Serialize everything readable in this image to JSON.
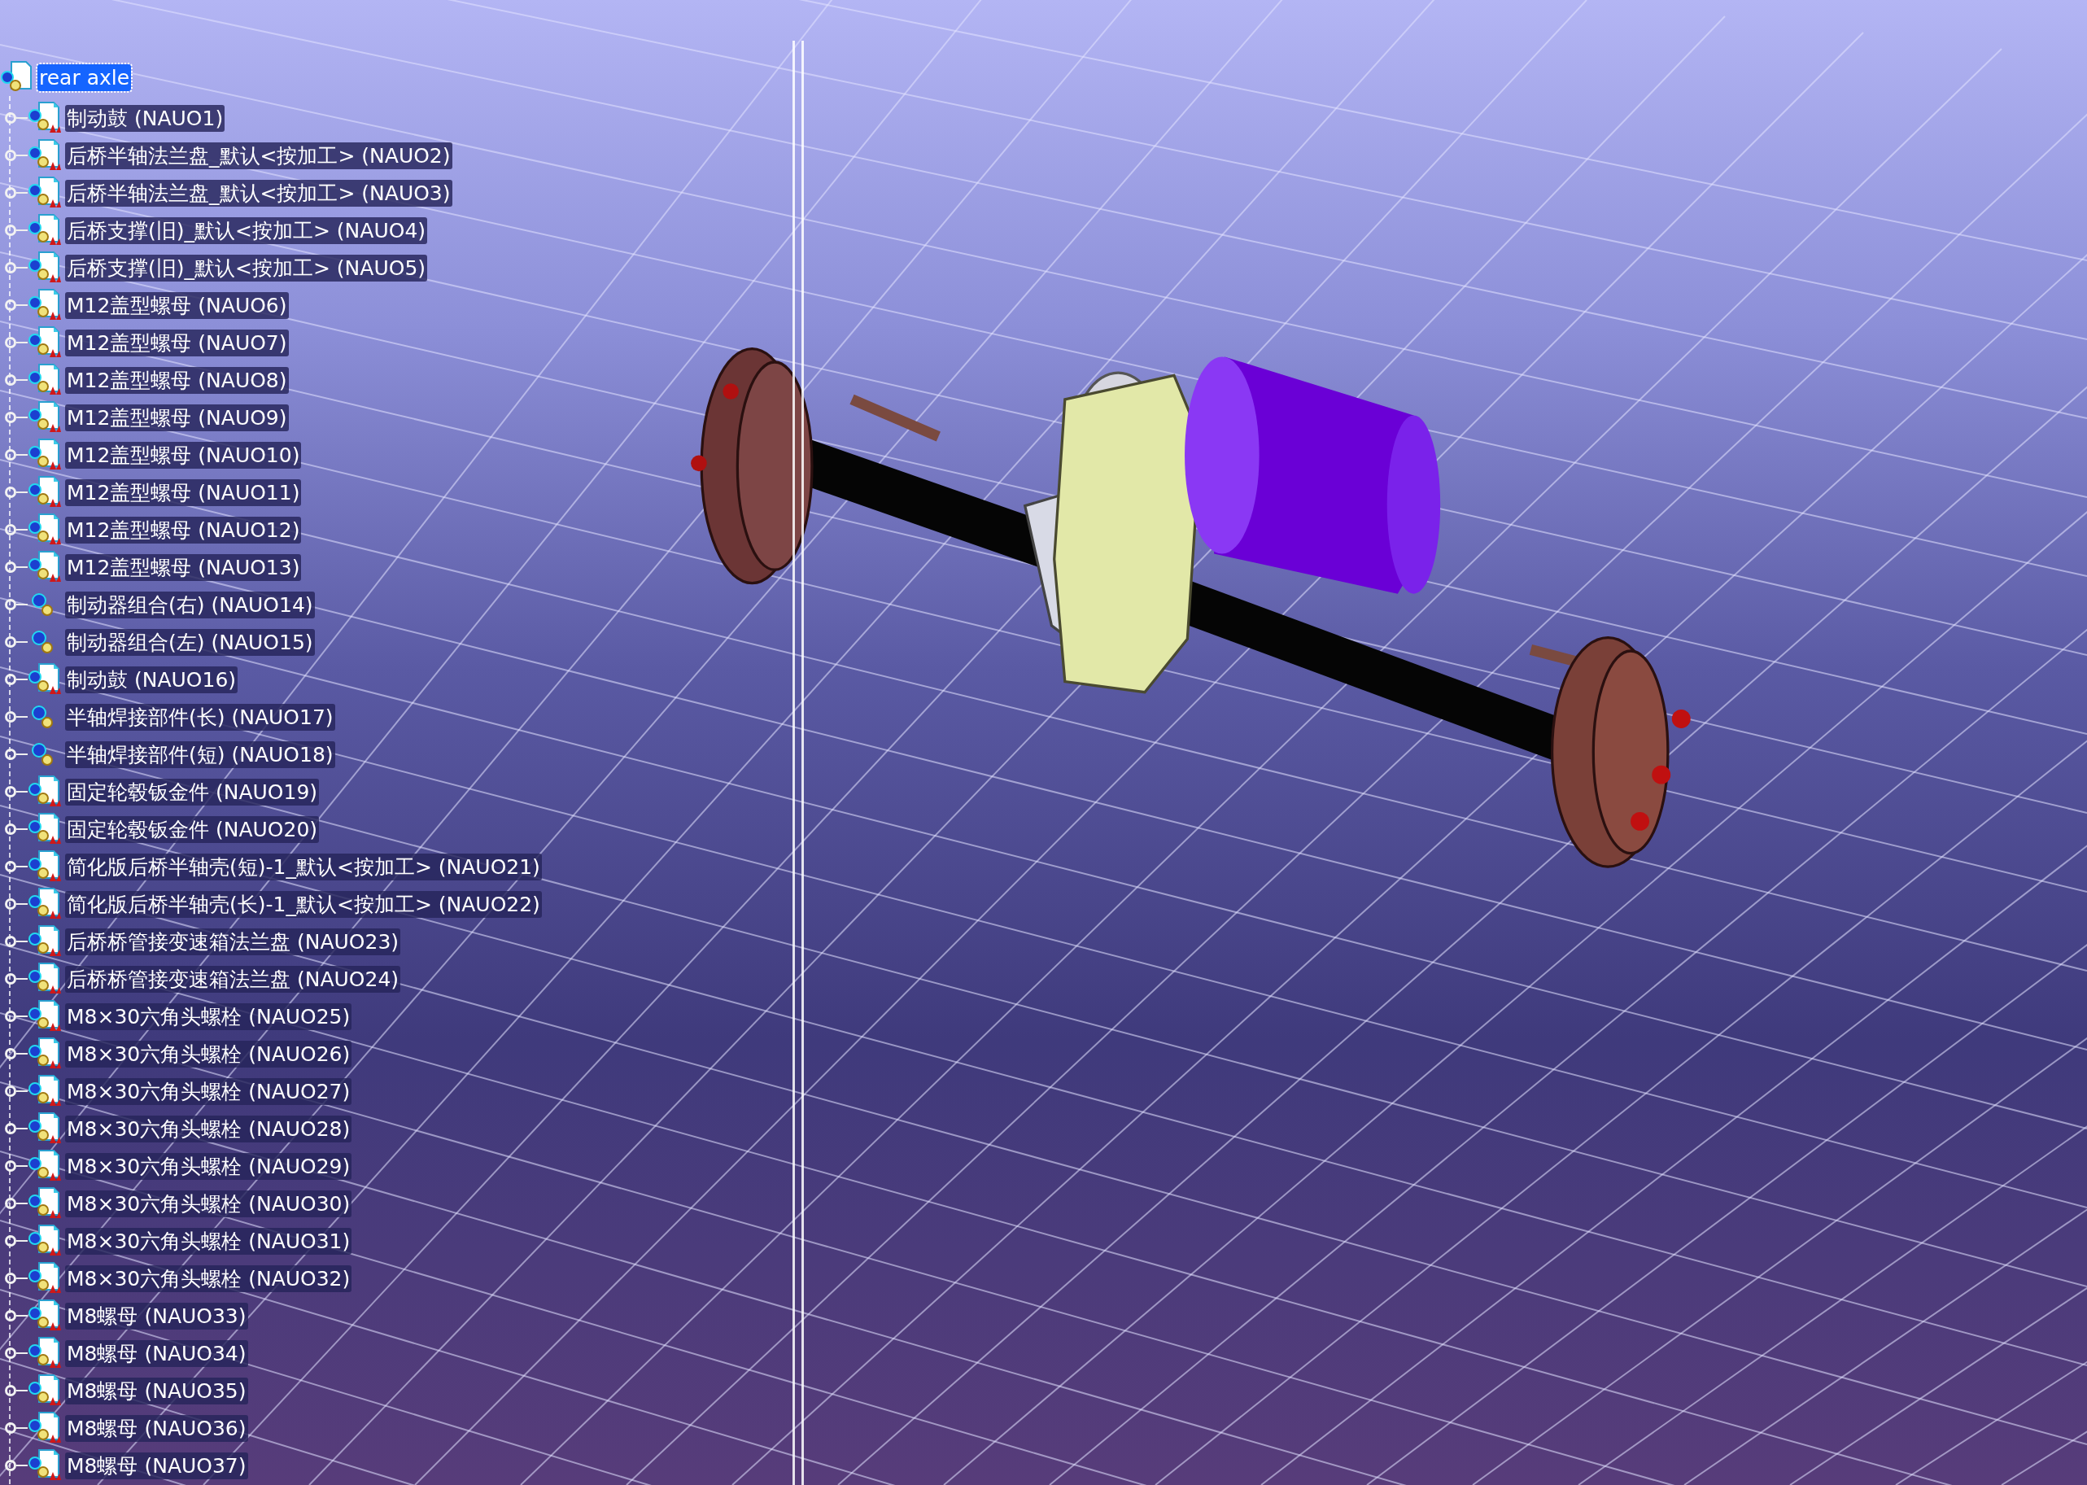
{
  "tree": {
    "label": "rear axle",
    "selected": true,
    "children": [
      {
        "label": "制动鼓 (NAUO1)",
        "kind": "part",
        "selected": false
      },
      {
        "label": "后桥半轴法兰盘_默认<按加工> (NAUO2)",
        "kind": "part",
        "selected": false
      },
      {
        "label": "后桥半轴法兰盘_默认<按加工> (NAUO3)",
        "kind": "part",
        "selected": false
      },
      {
        "label": "后桥支撑(旧)_默认<按加工> (NAUO4)",
        "kind": "part",
        "selected": false
      },
      {
        "label": "后桥支撑(旧)_默认<按加工> (NAUO5)",
        "kind": "part",
        "selected": false
      },
      {
        "label": "M12盖型螺母 (NAUO6)",
        "kind": "part",
        "selected": false
      },
      {
        "label": "M12盖型螺母 (NAUO7)",
        "kind": "part",
        "selected": false
      },
      {
        "label": "M12盖型螺母 (NAUO8)",
        "kind": "part",
        "selected": false
      },
      {
        "label": "M12盖型螺母 (NAUO9)",
        "kind": "part",
        "selected": false
      },
      {
        "label": "M12盖型螺母 (NAUO10)",
        "kind": "part",
        "selected": false
      },
      {
        "label": "M12盖型螺母 (NAUO11)",
        "kind": "part",
        "selected": false
      },
      {
        "label": "M12盖型螺母 (NAUO12)",
        "kind": "part",
        "selected": false
      },
      {
        "label": "M12盖型螺母 (NAUO13)",
        "kind": "part",
        "selected": false
      },
      {
        "label": "制动器组合(右) (NAUO14)",
        "kind": "product",
        "selected": false
      },
      {
        "label": "制动器组合(左) (NAUO15)",
        "kind": "product",
        "selected": false
      },
      {
        "label": "制动鼓 (NAUO16)",
        "kind": "part",
        "selected": false
      },
      {
        "label": "半轴焊接部件(长) (NAUO17)",
        "kind": "product",
        "selected": false
      },
      {
        "label": "半轴焊接部件(短) (NAUO18)",
        "kind": "product",
        "selected": false
      },
      {
        "label": "固定轮毂钣金件 (NAUO19)",
        "kind": "part",
        "selected": false
      },
      {
        "label": "固定轮毂钣金件 (NAUO20)",
        "kind": "part",
        "selected": false
      },
      {
        "label": "简化版后桥半轴壳(短)-1_默认<按加工> (NAUO21)",
        "kind": "part",
        "selected": false
      },
      {
        "label": "简化版后桥半轴壳(长)-1_默认<按加工> (NAUO22)",
        "kind": "part",
        "selected": false
      },
      {
        "label": "后桥桥管接变速箱法兰盘 (NAUO23)",
        "kind": "part",
        "selected": false
      },
      {
        "label": "后桥桥管接变速箱法兰盘 (NAUO24)",
        "kind": "part",
        "selected": false
      },
      {
        "label": "M8×30六角头螺栓 (NAUO25)",
        "kind": "part",
        "selected": false
      },
      {
        "label": "M8×30六角头螺栓 (NAUO26)",
        "kind": "part",
        "selected": false
      },
      {
        "label": "M8×30六角头螺栓 (NAUO27)",
        "kind": "part",
        "selected": false
      },
      {
        "label": "M8×30六角头螺栓 (NAUO28)",
        "kind": "part",
        "selected": false
      },
      {
        "label": "M8×30六角头螺栓 (NAUO29)",
        "kind": "part",
        "selected": false
      },
      {
        "label": "M8×30六角头螺栓 (NAUO30)",
        "kind": "part",
        "selected": false
      },
      {
        "label": "M8×30六角头螺栓 (NAUO31)",
        "kind": "part",
        "selected": false
      },
      {
        "label": "M8×30六角头螺栓 (NAUO32)",
        "kind": "part",
        "selected": false
      },
      {
        "label": "M8螺母 (NAUO33)",
        "kind": "part",
        "selected": false
      },
      {
        "label": "M8螺母 (NAUO34)",
        "kind": "part",
        "selected": false
      },
      {
        "label": "M8螺母 (NAUO35)",
        "kind": "part",
        "selected": false
      },
      {
        "label": "M8螺母 (NAUO36)",
        "kind": "part",
        "selected": false
      },
      {
        "label": "M8螺母 (NAUO37)",
        "kind": "part",
        "selected": false
      }
    ]
  }
}
